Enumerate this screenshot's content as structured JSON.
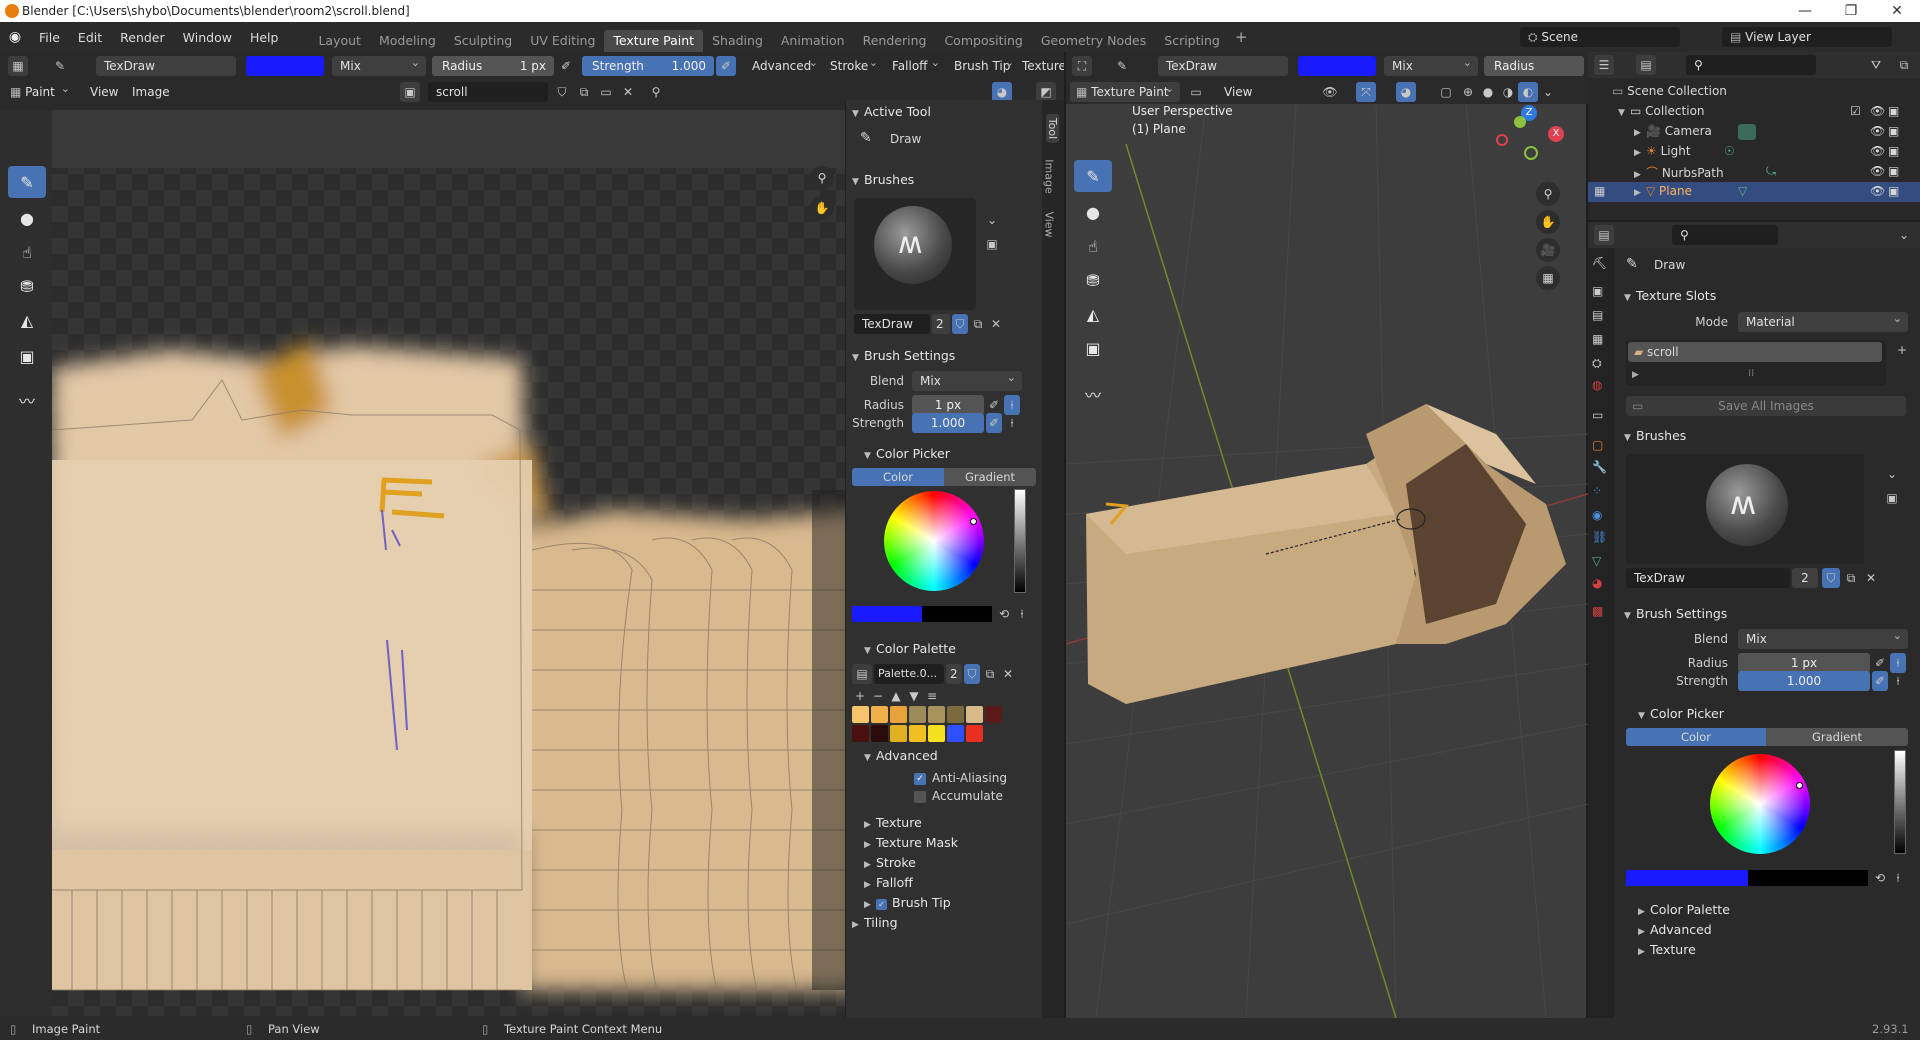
{
  "window": {
    "title": "Blender [C:\\Users\\shybo\\Documents\\blender\\room2\\scroll.blend]",
    "minimize": "—",
    "maximize": "❐",
    "close": "✕"
  },
  "menu": [
    "File",
    "Edit",
    "Render",
    "Window",
    "Help"
  ],
  "workspaces": [
    "Layout",
    "Modeling",
    "Sculpting",
    "UV Editing",
    "Texture Paint",
    "Shading",
    "Animation",
    "Rendering",
    "Compositing",
    "Geometry Nodes",
    "Scripting"
  ],
  "active_workspace": "Texture Paint",
  "scene": {
    "label": "Scene",
    "view_layer": "View Layer"
  },
  "image_editor": {
    "brush_name": "TexDraw",
    "color": "#1a1aff",
    "blend": "Mix",
    "radius_label": "Radius",
    "radius_value": "1 px",
    "strength_label": "Strength",
    "strength_value": "1.000",
    "header_items": [
      "Advanced",
      "Stroke",
      "Falloff",
      "Brush Tip",
      "Texture"
    ],
    "mode": "Paint",
    "menus": [
      "View",
      "Image"
    ],
    "image_name": "scroll",
    "tabs": [
      "Tool",
      "Image",
      "View"
    ]
  },
  "tool_panel": {
    "active_tool_header": "Active Tool",
    "active_tool": "Draw",
    "brushes_header": "Brushes",
    "brush_name": "TexDraw",
    "brush_users": "2",
    "brush_settings_header": "Brush Settings",
    "blend_label": "Blend",
    "blend_value": "Mix",
    "radius_label": "Radius",
    "radius_value": "1 px",
    "strength_label": "Strength",
    "strength_value": "1.000",
    "color_picker_header": "Color Picker",
    "color_tab": "Color",
    "gradient_tab": "Gradient",
    "color_palette_header": "Color Palette",
    "palette_name": "Palette.0...",
    "palette_users": "2",
    "palette_colors": [
      "#f5c46b",
      "#f0b04a",
      "#e8a43a",
      "#9c8a58",
      "#a8935c",
      "#7a6a3e",
      "#d9b98a",
      "#5a1a1a",
      "#4a1010",
      "#2a0a0a",
      "#e0b020",
      "#f0c020",
      "#f5e020",
      "#3050ff",
      "#e83020"
    ],
    "advanced_header": "Advanced",
    "anti_aliasing": "Anti-Aliasing",
    "accumulate": "Accumulate",
    "collapsed": [
      "Texture",
      "Texture Mask",
      "Stroke",
      "Falloff"
    ],
    "brush_tip": "Brush Tip",
    "tiling": "Tiling"
  },
  "viewport": {
    "brush_name": "TexDraw",
    "blend": "Mix",
    "radius_label": "Radius",
    "mode": "Texture Paint",
    "view_menu": "View",
    "overlay_title": "User Perspective",
    "overlay_object": "(1) Plane"
  },
  "outliner": {
    "root": "Scene Collection",
    "collection": "Collection",
    "items": [
      "Camera",
      "Light",
      "NurbsPath",
      "Plane"
    ]
  },
  "properties": {
    "tool": "Draw",
    "texture_slots_header": "Texture Slots",
    "mode_label": "Mode",
    "mode_value": "Material",
    "slot": "scroll",
    "save_all": "Save All Images",
    "brushes_header": "Brushes",
    "brush_name": "TexDraw",
    "brush_users": "2",
    "brush_settings_header": "Brush Settings",
    "blend_label": "Blend",
    "blend_value": "Mix",
    "radius_label": "Radius",
    "radius_value": "1 px",
    "strength_label": "Strength",
    "strength_value": "1.000",
    "color_picker_header": "Color Picker",
    "color_tab": "Color",
    "gradient_tab": "Gradient",
    "collapsed": [
      "Color Palette",
      "Advanced",
      "Texture"
    ]
  },
  "statusbar": {
    "items": [
      "Image Paint",
      "Pan View",
      "Texture Paint Context Menu"
    ],
    "version": "2.93.1"
  }
}
